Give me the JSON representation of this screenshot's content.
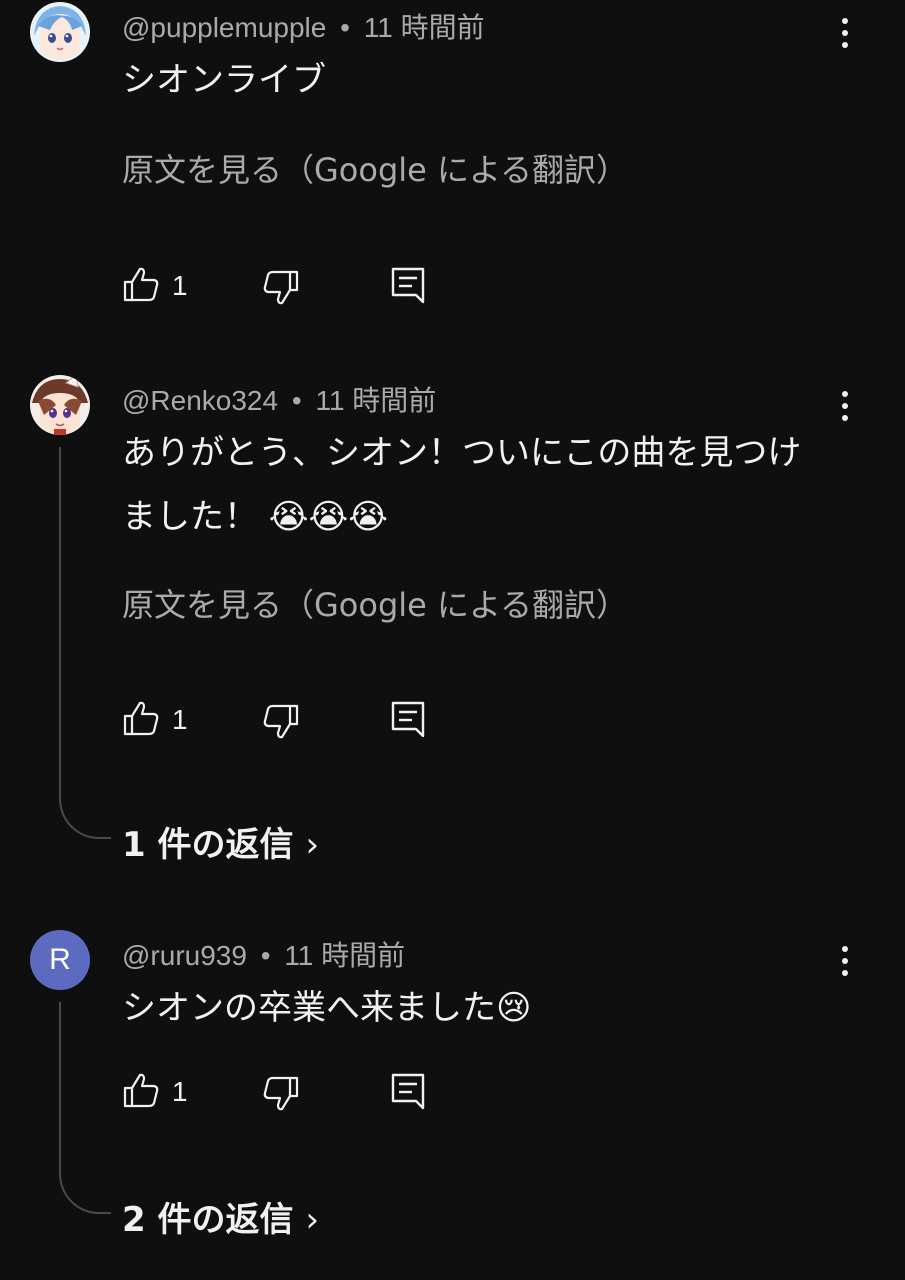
{
  "comments": [
    {
      "username": "@pupplemupple",
      "separator": "•",
      "time": "11 時間前",
      "text": "シオンライブ",
      "translate_link": "原文を見る（Google による翻訳）",
      "likes": "1",
      "avatar": "anime-avatar-blue-hair",
      "replies_label": ""
    },
    {
      "username": "@Renko324",
      "separator": "•",
      "time": "11 時間前",
      "text_line1": "ありがとう、シオン！ついにこの曲を見つけ",
      "text_line2": "ました！ 😭😭😭",
      "translate_link": "原文を見る（Google による翻訳）",
      "likes": "1",
      "avatar": "anime-avatar-brown-hat",
      "replies_label": "1 件の返信"
    },
    {
      "username": "@ruru939",
      "separator": "•",
      "time": "11 時間前",
      "text": "シオンの卒業へ来ました😢",
      "likes": "1",
      "avatar_letter": "R",
      "avatar_color": "#5c6bc0",
      "replies_label": "2 件の返信"
    }
  ],
  "icons": {
    "like": "thumbs-up-icon",
    "dislike": "thumbs-down-icon",
    "reply": "reply-comment-icon",
    "more": "more-vertical-icon",
    "chevron": "chevron-right-icon"
  },
  "glyphs": {
    "chevron": "›"
  },
  "colors": {
    "background": "#0f0f0f",
    "primary_text": "#f1f1f1",
    "secondary_text": "#aaaaaa",
    "thread_line": "#4a4a4a",
    "avatar_r": "#5c6bc0"
  }
}
